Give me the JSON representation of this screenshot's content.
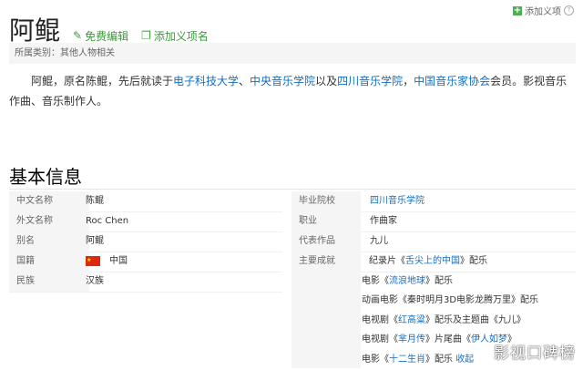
{
  "header": {
    "add_item": "添加义项",
    "help": "?",
    "title": "阿鲲",
    "edit": "免费编辑",
    "add_name": "添加义项名"
  },
  "category": "所属类别：其他人物相关",
  "summary": {
    "t1": "阿鲲，原名陈鲲，先后就读于",
    "l1": "电子科技大学",
    "t2": "、",
    "l2": "中央音乐学院",
    "t3": "以及",
    "l3": "四川音乐学院",
    "t4": "，",
    "l4": "中国音乐家协会",
    "t5": "会员。影视音乐作曲、音乐制作人。"
  },
  "section_title": "基本信息",
  "left": [
    {
      "label": "中文名称",
      "value": "陈鲲"
    },
    {
      "label": "外文名称",
      "value": "Roc Chen"
    },
    {
      "label": "别名",
      "value": "阿鲲"
    },
    {
      "label": "国籍",
      "value": "中国"
    },
    {
      "label": "民族",
      "value": "汉族"
    }
  ],
  "right": [
    {
      "label": "毕业院校",
      "value": "四川音乐学院"
    },
    {
      "label": "职业",
      "value": "作曲家"
    },
    {
      "label": "代表作品",
      "value": "九儿"
    },
    {
      "label": "主要成就",
      "value": ""
    }
  ],
  "achievements": [
    {
      "a": "纪录片《",
      "l": "舌尖上的中国",
      "b": "》配乐"
    },
    {
      "a": "电影《",
      "l": "流浪地球",
      "b": "》配乐"
    },
    {
      "a": "动画电影《秦时明月3D电影龙腾万里》配乐",
      "l": "",
      "b": ""
    },
    {
      "a": "电视剧《",
      "l": "红高粱",
      "b": "》配乐及主题曲《九儿》"
    },
    {
      "a": "电视剧《",
      "l": "芈月传",
      "b": "》片尾曲《",
      "l2": "伊人如梦",
      "c": "》"
    },
    {
      "a": "电影《",
      "l": "十二生肖",
      "b": "》配乐 ",
      "l2": "收起",
      "c": ""
    }
  ],
  "watermark": "影视口碑榜"
}
